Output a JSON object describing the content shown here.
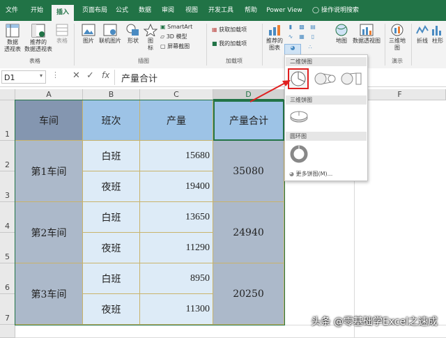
{
  "ribbon_tabs": [
    "文件",
    "开始",
    "插入",
    "页面布局",
    "公式",
    "数据",
    "审阅",
    "视图",
    "开发工具",
    "帮助",
    "Power View"
  ],
  "active_tab": "插入",
  "tell_me": "操作说明搜索",
  "ribbon": {
    "pivot_table": "数据\n透视表",
    "recommended_pivot": "推荐的\n数据透视表",
    "table": "表格",
    "picture": "图片",
    "online_picture": "联机图片",
    "shapes": "形状",
    "icons": "图\n标",
    "smartart": "SmartArt",
    "model_3d": "3D 模型",
    "screenshot": "屏幕截图",
    "get_addins": "获取加载项",
    "my_addins": "我的加载项",
    "recommended_charts": "推荐的\n图表",
    "maps": "地图",
    "pivot_chart": "数据透视图",
    "map_3d": "三维地\n图",
    "line": "折线",
    "column": "柱形",
    "group_tables": "表格",
    "group_illustrations": "插图",
    "group_addins": "加载项",
    "group_tours": "演示"
  },
  "name_box": "D1",
  "formula_value": "产量合计",
  "columns": [
    "A",
    "B",
    "C",
    "D",
    "E",
    "F"
  ],
  "rows": [
    "1",
    "2",
    "3",
    "4",
    "5",
    "6",
    "7"
  ],
  "table": {
    "headers": [
      "车间",
      "班次",
      "产量",
      "产量合计"
    ],
    "workshops": [
      "第1车间",
      "第2车间",
      "第3车间"
    ],
    "shifts": [
      "白班",
      "夜班",
      "白班",
      "夜班",
      "白班",
      "夜班"
    ],
    "output": [
      "15680",
      "19400",
      "13650",
      "11290",
      "8950",
      "11300"
    ],
    "totals": [
      "35080",
      "24940",
      "20250"
    ]
  },
  "dropdown": {
    "section_2d": "二维饼图",
    "section_3d": "三维饼图",
    "section_donut": "圆环图",
    "more": "更多饼图(M)..."
  },
  "watermark": "头条 @零基础学Excel之速成",
  "colors": {
    "excel_green": "#217346",
    "header_blue": "#9dc3e6",
    "workshop_fill": "#8496b0",
    "shift_fill": "#ddebf7",
    "total_fill": "#acb9ca",
    "highlight_red": "#e02020"
  }
}
